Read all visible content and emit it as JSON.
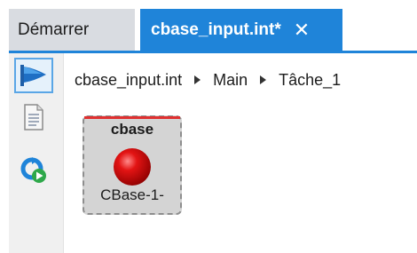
{
  "tabs": [
    {
      "label": "Démarrer",
      "active": false
    },
    {
      "label": "cbase_input.int*",
      "active": true,
      "close_icon": "close-icon"
    }
  ],
  "colors": {
    "accent": "#1f84d9",
    "led": "#d40000",
    "block_top_line": "#e03030"
  },
  "toolbar": {
    "buttons": [
      {
        "icon": "run-flag-icon",
        "selected": true
      },
      {
        "icon": "document-icon",
        "selected": false
      },
      {
        "icon": "refresh-run-icon",
        "selected": false
      }
    ]
  },
  "breadcrumb": [
    "cbase_input.int",
    "Main",
    "Tâche_1"
  ],
  "block": {
    "title": "cbase",
    "label": "CBase-1-",
    "status_icon": "red-led-icon"
  }
}
